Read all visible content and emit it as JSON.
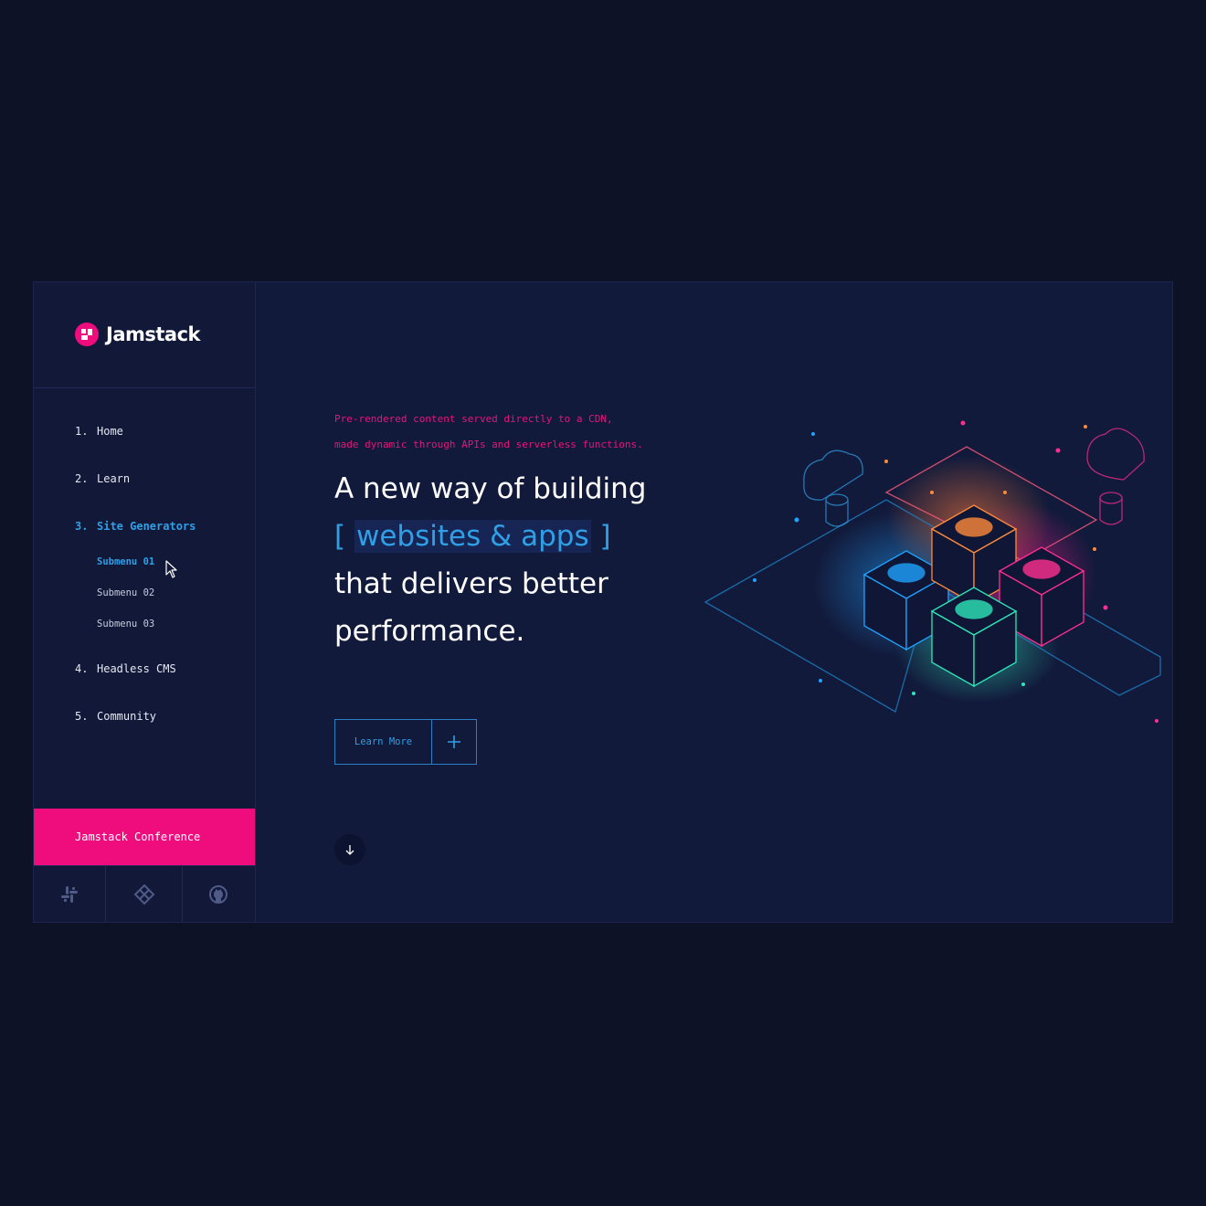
{
  "brand": {
    "name": "Jamstack",
    "accent": "#ef0d7e",
    "primary": "#2f9fe6",
    "background": "#121a3b"
  },
  "sidebar": {
    "items": [
      {
        "num": "1.",
        "label": "Home"
      },
      {
        "num": "2.",
        "label": "Learn"
      },
      {
        "num": "3.",
        "label": "Site Generators",
        "active": true
      },
      {
        "num": "4.",
        "label": "Headless CMS"
      },
      {
        "num": "5.",
        "label": "Community"
      }
    ],
    "submenu": [
      {
        "label": "Submenu 01",
        "active": true
      },
      {
        "label": "Submenu 02"
      },
      {
        "label": "Submenu 03"
      }
    ],
    "conference_label": "Jamstack Conference",
    "social_icons": [
      "slack-icon",
      "netlify-icon",
      "github-icon"
    ]
  },
  "hero": {
    "tagline_line1": "Pre-rendered content served directly to a CDN,",
    "tagline_line2": "made dynamic through APIs and serverless functions.",
    "headline_line1": "A new way of building",
    "headline_open_bracket": "[",
    "headline_highlight": "websites & apps",
    "headline_close_bracket": "]",
    "headline_line3": "that delivers better",
    "headline_line4": "performance.",
    "cta_label": "Learn More",
    "cta_icon": "plus-icon",
    "scroll_icon": "arrow-down-icon"
  }
}
